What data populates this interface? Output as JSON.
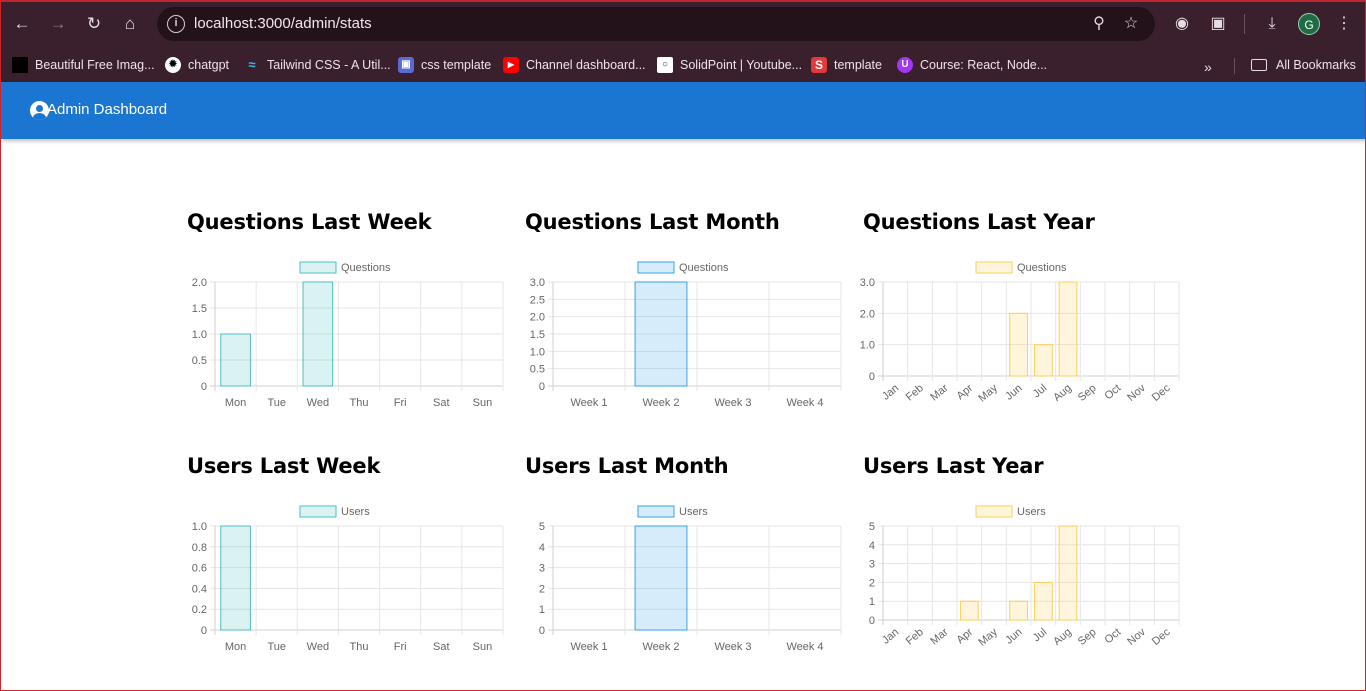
{
  "browser": {
    "url": "localhost:3000/admin/stats",
    "profile_initial": "G",
    "bookmarks": [
      {
        "label": "Beautiful Free Imag...",
        "icon": "unsplash-icon",
        "color": "#000000"
      },
      {
        "label": "chatgpt",
        "icon": "openai-icon",
        "color": "#000000"
      },
      {
        "label": "Tailwind CSS - A Util...",
        "icon": "tailwind-icon",
        "color": "#38bdf8"
      },
      {
        "label": "css template",
        "icon": "template-icon",
        "color": "#5b6ad0"
      },
      {
        "label": "Channel dashboard...",
        "icon": "youtube-icon",
        "color": "#ff0000"
      },
      {
        "label": "SolidPoint | Youtube...",
        "icon": "solidpoint-icon",
        "color": "#ffffff"
      },
      {
        "label": "template",
        "icon": "s-icon",
        "color": "#e03a3a"
      },
      {
        "label": "Course: React, Node...",
        "icon": "udemy-icon",
        "color": "#a435f0"
      }
    ],
    "all_bookmarks_label": "All Bookmarks"
  },
  "app": {
    "title": "Admin Dashboard",
    "bar_color": "#1b76d2"
  },
  "chart_data": [
    {
      "type": "bar",
      "title": "Questions Last Week",
      "series": [
        {
          "name": "Questions",
          "values": [
            1,
            0,
            2,
            0,
            0,
            0,
            0
          ]
        }
      ],
      "categories": [
        "Mon",
        "Tue",
        "Wed",
        "Thu",
        "Fri",
        "Sat",
        "Sun"
      ],
      "yticks": [
        "0",
        "0.5",
        "1.0",
        "1.5",
        "2.0"
      ],
      "ylim": [
        0,
        2
      ],
      "color": "#4bc0c0",
      "grid": true,
      "legend": "top"
    },
    {
      "type": "bar",
      "title": "Questions Last Month",
      "series": [
        {
          "name": "Questions",
          "values": [
            0,
            3,
            0,
            0
          ]
        }
      ],
      "categories": [
        "Week 1",
        "Week 2",
        "Week 3",
        "Week 4"
      ],
      "yticks": [
        "0",
        "0.5",
        "1.0",
        "1.5",
        "2.0",
        "2.5",
        "3.0"
      ],
      "ylim": [
        0,
        3
      ],
      "color": "#36a2eb",
      "grid": true,
      "legend": "top"
    },
    {
      "type": "bar",
      "title": "Questions Last Year",
      "series": [
        {
          "name": "Questions",
          "values": [
            0,
            0,
            0,
            0,
            0,
            2,
            1,
            3,
            0,
            0,
            0,
            0
          ]
        }
      ],
      "categories": [
        "Jan",
        "Feb",
        "Mar",
        "Apr",
        "May",
        "Jun",
        "Jul",
        "Aug",
        "Sep",
        "Oct",
        "Nov",
        "Dec"
      ],
      "yticks": [
        "0",
        "1.0",
        "2.0",
        "3.0"
      ],
      "ylim": [
        0,
        3
      ],
      "color": "#ffce56",
      "grid": true,
      "legend": "top"
    },
    {
      "type": "bar",
      "title": "Users Last Week",
      "series": [
        {
          "name": "Users",
          "values": [
            1,
            0,
            0,
            0,
            0,
            0,
            0
          ]
        }
      ],
      "categories": [
        "Mon",
        "Tue",
        "Wed",
        "Thu",
        "Fri",
        "Sat",
        "Sun"
      ],
      "yticks": [
        "0",
        "0.2",
        "0.4",
        "0.6",
        "0.8",
        "1.0"
      ],
      "ylim": [
        0,
        1
      ],
      "color": "#4bc0c0",
      "grid": true,
      "legend": "top"
    },
    {
      "type": "bar",
      "title": "Users Last Month",
      "series": [
        {
          "name": "Users",
          "values": [
            0,
            5,
            0,
            0
          ]
        }
      ],
      "categories": [
        "Week 1",
        "Week 2",
        "Week 3",
        "Week 4"
      ],
      "yticks": [
        "0",
        "1",
        "2",
        "3",
        "4",
        "5"
      ],
      "ylim": [
        0,
        5
      ],
      "color": "#36a2eb",
      "grid": true,
      "legend": "top"
    },
    {
      "type": "bar",
      "title": "Users Last Year",
      "series": [
        {
          "name": "Users",
          "values": [
            0,
            0,
            0,
            1,
            0,
            1,
            2,
            5,
            0,
            0,
            0,
            0
          ]
        }
      ],
      "categories": [
        "Jan",
        "Feb",
        "Mar",
        "Apr",
        "May",
        "Jun",
        "Jul",
        "Aug",
        "Sep",
        "Oct",
        "Nov",
        "Dec"
      ],
      "yticks": [
        "0",
        "1",
        "2",
        "3",
        "4",
        "5"
      ],
      "ylim": [
        0,
        5
      ],
      "color": "#ffce56",
      "grid": true,
      "legend": "top"
    }
  ]
}
